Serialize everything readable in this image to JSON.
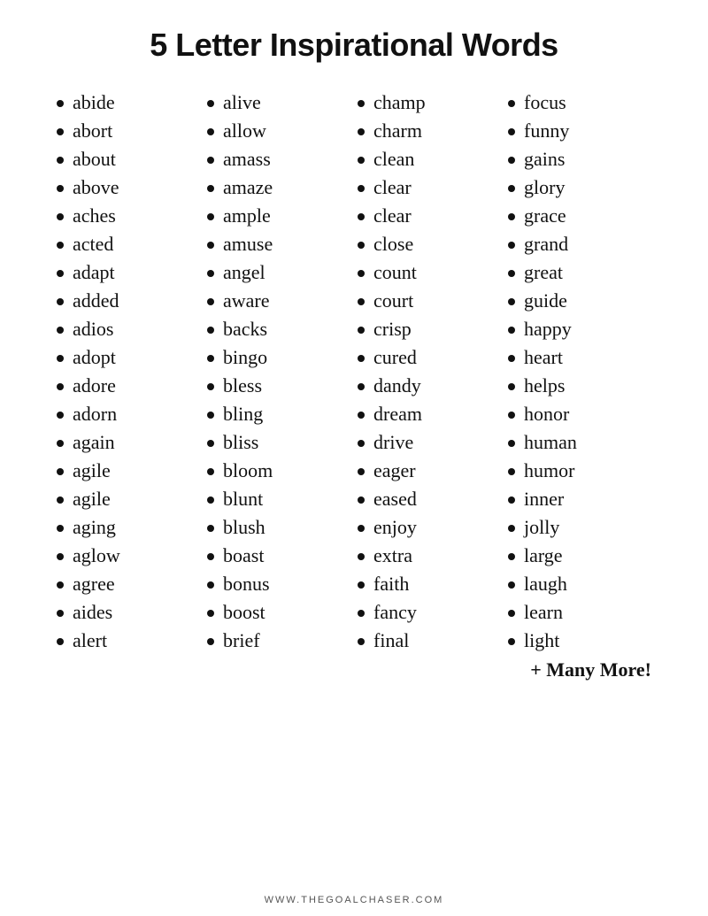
{
  "title": "5 Letter Inspirational Words",
  "footer": "WWW.THEGOALCHASER.COM",
  "more_text": "+ Many More!",
  "columns": [
    {
      "id": "col1",
      "words": [
        "abide",
        "abort",
        "about",
        "above",
        "aches",
        "acted",
        "adapt",
        "added",
        "adios",
        "adopt",
        "adore",
        "adorn",
        "again",
        "agile",
        "agile",
        "aging",
        "aglow",
        "agree",
        "aides",
        "alert"
      ]
    },
    {
      "id": "col2",
      "words": [
        "alive",
        "allow",
        "amass",
        "amaze",
        "ample",
        "amuse",
        "angel",
        "aware",
        "backs",
        "bingo",
        "bless",
        "bling",
        "bliss",
        "bloom",
        "blunt",
        "blush",
        "boast",
        "bonus",
        "boost",
        "brief"
      ]
    },
    {
      "id": "col3",
      "words": [
        "champ",
        "charm",
        "clean",
        "clear",
        "clear",
        "close",
        "count",
        "court",
        "crisp",
        "cured",
        "dandy",
        "dream",
        "drive",
        "eager",
        "eased",
        "enjoy",
        "extra",
        "faith",
        "fancy",
        "final"
      ]
    },
    {
      "id": "col4",
      "words": [
        "focus",
        "funny",
        "gains",
        "glory",
        "grace",
        "grand",
        "great",
        "guide",
        "happy",
        "heart",
        "helps",
        "honor",
        "human",
        "humor",
        "inner",
        "jolly",
        "large",
        "laugh",
        "learn",
        "light"
      ]
    }
  ]
}
